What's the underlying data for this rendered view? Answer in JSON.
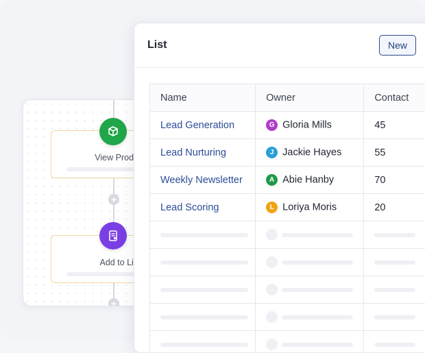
{
  "workflow": {
    "nodes": [
      {
        "label": "View Product",
        "icon": "box-icon",
        "color": "#21a64a"
      },
      {
        "label": "Add to List",
        "icon": "clipboard-icon",
        "color": "#7a3fe4"
      }
    ]
  },
  "list_panel": {
    "title": "List",
    "new_button": "New",
    "columns": [
      "Name",
      "Owner",
      "Contact"
    ],
    "rows": [
      {
        "name": "Lead Generation",
        "owner": "Gloria Mills",
        "initial": "G",
        "avatar_color": "#b13bc9",
        "contacts": "45"
      },
      {
        "name": "Lead Nurturing",
        "owner": "Jackie Hayes",
        "initial": "J",
        "avatar_color": "#2a9fd8",
        "contacts": "55"
      },
      {
        "name": "Weekly Newsletter",
        "owner": "Abie Hanby",
        "initial": "A",
        "avatar_color": "#1f9a4a",
        "contacts": "70"
      },
      {
        "name": "Lead Scoring",
        "owner": "Loriya Moris",
        "initial": "L",
        "avatar_color": "#f0a314",
        "contacts": "20"
      }
    ]
  },
  "colors": {
    "link": "#2c4c96",
    "accent_button": "#2d4a8a"
  }
}
